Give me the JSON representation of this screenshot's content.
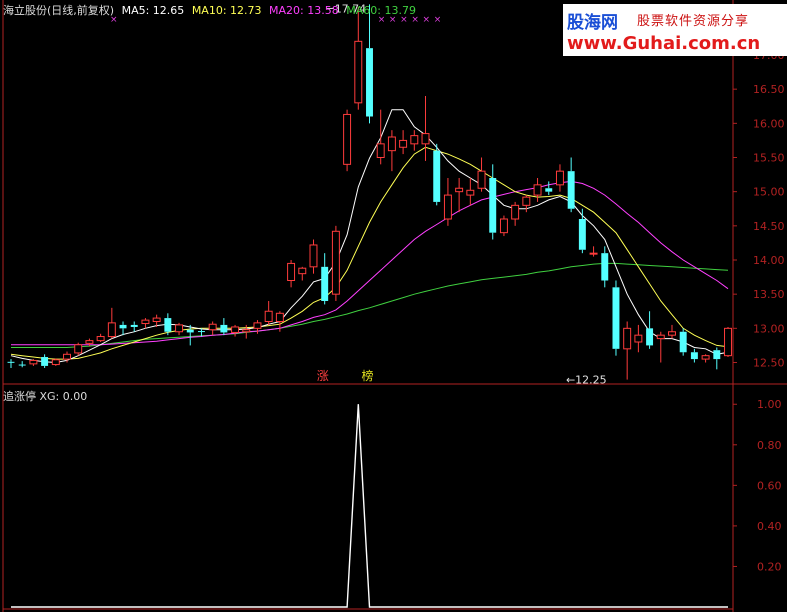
{
  "header": {
    "stock_title": "海立股份(日线,前复权)",
    "ma5": "MA5: 12.65",
    "ma10": "MA10: 12.73",
    "ma20": "MA20: 13.58",
    "ma60": "MA60: 13.79"
  },
  "indicator": {
    "name": "追涨停",
    "xg": "XG: 0.00"
  },
  "watermark": {
    "cn": "股海网",
    "sub": "股票软件资源分享",
    "url": "www.Guhai.com.cn"
  },
  "markers": {
    "tag1": "涨",
    "tag2": "榜"
  },
  "colors": {
    "up": "#ff3c3c",
    "down": "#54ffff",
    "ma5": "#ffffff",
    "ma10": "#ffff55",
    "ma20": "#ff40ff",
    "ma60": "#40d040",
    "axis": "#b22222",
    "label": "#b22222"
  },
  "chart_data": [
    {
      "type": "candlestick",
      "title": "海立股份(日线,前复权)",
      "ylim": [
        12.2,
        17.6
      ],
      "yticks": [
        12.5,
        13.0,
        13.5,
        14.0,
        14.5,
        15.0,
        15.5,
        16.0,
        16.5,
        17.0
      ],
      "annotations": [
        {
          "text": "17.74",
          "x": 28,
          "y": 17.74
        },
        {
          "text": "←12.25",
          "x": 49,
          "y": 12.25
        }
      ],
      "candles": [
        [
          12.51,
          12.55,
          12.42,
          12.5
        ],
        [
          12.47,
          12.52,
          12.43,
          12.46
        ],
        [
          12.48,
          12.55,
          12.45,
          12.53
        ],
        [
          12.58,
          12.62,
          12.42,
          12.45
        ],
        [
          12.47,
          12.56,
          12.45,
          12.54
        ],
        [
          12.55,
          12.66,
          12.5,
          12.62
        ],
        [
          12.64,
          12.79,
          12.6,
          12.76
        ],
        [
          12.78,
          12.85,
          12.74,
          12.82
        ],
        [
          12.82,
          12.92,
          12.8,
          12.88
        ],
        [
          12.88,
          13.3,
          12.85,
          13.08
        ],
        [
          13.05,
          13.1,
          12.9,
          13.0
        ],
        [
          13.05,
          13.1,
          12.95,
          13.02
        ],
        [
          13.07,
          13.15,
          13.0,
          13.12
        ],
        [
          13.1,
          13.2,
          13.02,
          13.15
        ],
        [
          13.15,
          13.22,
          12.9,
          12.95
        ],
        [
          12.95,
          13.08,
          12.9,
          13.05
        ],
        [
          12.98,
          13.05,
          12.75,
          12.94
        ],
        [
          12.96,
          13.0,
          12.88,
          12.95
        ],
        [
          12.98,
          13.1,
          12.9,
          13.06
        ],
        [
          13.05,
          13.15,
          12.9,
          12.94
        ],
        [
          12.94,
          13.05,
          12.88,
          13.02
        ],
        [
          12.95,
          13.05,
          12.85,
          12.98
        ],
        [
          13.0,
          13.12,
          12.92,
          13.08
        ],
        [
          13.1,
          13.4,
          13.05,
          13.25
        ],
        [
          13.1,
          13.25,
          12.95,
          13.22
        ],
        [
          13.7,
          14.0,
          13.6,
          13.95
        ],
        [
          13.8,
          13.9,
          13.7,
          13.88
        ],
        [
          13.9,
          14.3,
          13.8,
          14.22
        ],
        [
          13.9,
          14.1,
          13.35,
          13.4
        ],
        [
          13.5,
          14.5,
          13.4,
          14.42
        ],
        [
          15.4,
          16.2,
          15.3,
          16.13
        ],
        [
          16.3,
          17.7,
          16.2,
          17.2
        ],
        [
          17.1,
          17.74,
          16.0,
          16.1
        ],
        [
          15.5,
          16.2,
          15.4,
          15.7
        ],
        [
          15.6,
          15.9,
          15.3,
          15.8
        ],
        [
          15.65,
          15.9,
          15.55,
          15.75
        ],
        [
          15.7,
          15.9,
          15.6,
          15.82
        ],
        [
          15.7,
          16.4,
          15.45,
          15.85
        ],
        [
          15.6,
          15.7,
          14.8,
          14.85
        ],
        [
          14.6,
          15.2,
          14.5,
          14.95
        ],
        [
          15.0,
          15.2,
          14.7,
          15.05
        ],
        [
          14.95,
          15.2,
          14.8,
          15.02
        ],
        [
          15.05,
          15.5,
          15.0,
          15.3
        ],
        [
          15.2,
          15.4,
          14.3,
          14.4
        ],
        [
          14.4,
          14.65,
          14.35,
          14.6
        ],
        [
          14.6,
          14.85,
          14.5,
          14.8
        ],
        [
          14.8,
          14.95,
          14.7,
          14.92
        ],
        [
          14.95,
          15.2,
          14.85,
          15.1
        ],
        [
          15.05,
          15.15,
          14.95,
          15.0
        ],
        [
          15.1,
          15.4,
          15.0,
          15.3
        ],
        [
          15.3,
          15.5,
          14.7,
          14.75
        ],
        [
          14.6,
          14.75,
          14.1,
          14.15
        ],
        [
          14.1,
          14.2,
          14.05,
          14.1
        ],
        [
          14.1,
          14.2,
          13.6,
          13.7
        ],
        [
          13.6,
          13.7,
          12.6,
          12.7
        ],
        [
          12.7,
          13.1,
          12.25,
          13.0
        ],
        [
          12.8,
          13.05,
          12.65,
          12.9
        ],
        [
          13.0,
          13.25,
          12.7,
          12.75
        ],
        [
          12.85,
          12.95,
          12.5,
          12.9
        ],
        [
          12.9,
          13.05,
          12.85,
          12.95
        ],
        [
          12.95,
          13.0,
          12.6,
          12.65
        ],
        [
          12.65,
          12.7,
          12.5,
          12.55
        ],
        [
          12.55,
          12.62,
          12.5,
          12.6
        ],
        [
          12.68,
          12.72,
          12.4,
          12.55
        ],
        [
          12.6,
          13.02,
          12.58,
          13.0
        ]
      ],
      "ma5": [
        12.6,
        12.56,
        12.53,
        12.51,
        12.5,
        12.53,
        12.6,
        12.68,
        12.76,
        12.85,
        12.91,
        12.95,
        13.0,
        13.04,
        13.06,
        13.05,
        13.02,
        12.99,
        12.98,
        12.98,
        12.98,
        12.99,
        13.01,
        13.06,
        13.1,
        13.3,
        13.47,
        13.68,
        13.73,
        13.97,
        14.37,
        15.07,
        15.49,
        15.79,
        16.2,
        16.2,
        15.95,
        15.83,
        15.65,
        15.45,
        15.3,
        15.2,
        15.1,
        14.95,
        14.8,
        14.75,
        14.75,
        14.8,
        14.88,
        14.93,
        14.85,
        14.65,
        14.5,
        14.3,
        13.9,
        13.5,
        13.2,
        12.95,
        12.85,
        12.85,
        12.8,
        12.72,
        12.7,
        12.62,
        12.65
      ],
      "ma10": [
        12.62,
        12.6,
        12.58,
        12.56,
        12.55,
        12.55,
        12.56,
        12.6,
        12.64,
        12.7,
        12.75,
        12.8,
        12.85,
        12.9,
        12.94,
        12.97,
        12.99,
        13.0,
        13.0,
        13.0,
        13.0,
        13.01,
        13.02,
        13.04,
        13.06,
        13.15,
        13.25,
        13.38,
        13.45,
        13.6,
        13.85,
        14.2,
        14.55,
        14.85,
        15.1,
        15.35,
        15.55,
        15.65,
        15.6,
        15.55,
        15.48,
        15.4,
        15.3,
        15.2,
        15.1,
        15.0,
        14.95,
        14.92,
        14.93,
        14.95,
        14.9,
        14.8,
        14.7,
        14.55,
        14.4,
        14.15,
        13.9,
        13.65,
        13.4,
        13.2,
        13.0,
        12.9,
        12.82,
        12.75,
        12.73
      ],
      "ma20": [
        12.76,
        12.76,
        12.76,
        12.76,
        12.76,
        12.76,
        12.76,
        12.76,
        12.76,
        12.77,
        12.78,
        12.79,
        12.8,
        12.81,
        12.83,
        12.85,
        12.87,
        12.88,
        12.9,
        12.91,
        12.93,
        12.95,
        12.96,
        12.98,
        13.0,
        13.05,
        13.1,
        13.16,
        13.2,
        13.27,
        13.4,
        13.55,
        13.7,
        13.85,
        14.0,
        14.15,
        14.3,
        14.42,
        14.52,
        14.62,
        14.72,
        14.8,
        14.88,
        14.92,
        14.96,
        15.0,
        15.03,
        15.06,
        15.1,
        15.13,
        15.15,
        15.12,
        15.05,
        14.95,
        14.82,
        14.68,
        14.55,
        14.4,
        14.25,
        14.12,
        14.0,
        13.9,
        13.8,
        13.7,
        13.58
      ],
      "ma60": [
        12.72,
        12.72,
        12.72,
        12.72,
        12.72,
        12.72,
        12.73,
        12.74,
        12.76,
        12.78,
        12.8,
        12.82,
        12.84,
        12.85,
        12.86,
        12.87,
        12.88,
        12.89,
        12.9,
        12.91,
        12.92,
        12.94,
        12.96,
        12.98,
        13.0,
        13.03,
        13.06,
        13.1,
        13.13,
        13.17,
        13.21,
        13.26,
        13.3,
        13.35,
        13.4,
        13.45,
        13.5,
        13.54,
        13.58,
        13.62,
        13.65,
        13.68,
        13.71,
        13.73,
        13.75,
        13.77,
        13.79,
        13.82,
        13.84,
        13.87,
        13.9,
        13.92,
        13.94,
        13.95,
        13.95,
        13.94,
        13.93,
        13.92,
        13.91,
        13.9,
        13.89,
        13.88,
        13.87,
        13.86,
        13.85
      ]
    },
    {
      "type": "line",
      "title": "追涨停",
      "ylim": [
        0,
        1.09
      ],
      "yticks": [
        0.2,
        0.4,
        0.6,
        0.8,
        1.0
      ],
      "values": [
        0,
        0,
        0,
        0,
        0,
        0,
        0,
        0,
        0,
        0,
        0,
        0,
        0,
        0,
        0,
        0,
        0,
        0,
        0,
        0,
        0,
        0,
        0,
        0,
        0,
        0,
        0,
        0,
        0,
        0,
        0,
        1,
        0,
        0,
        0,
        0,
        0,
        0,
        0,
        0,
        0,
        0,
        0,
        0,
        0,
        0,
        0,
        0,
        0,
        0,
        0,
        0,
        0,
        0,
        0,
        0,
        0,
        0,
        0,
        0,
        0,
        0,
        0,
        0,
        0
      ]
    }
  ]
}
